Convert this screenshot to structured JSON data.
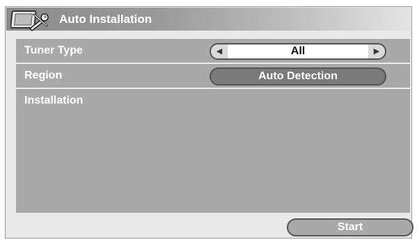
{
  "window": {
    "title": "Auto Installation",
    "title_icon": "tools-monitor-icon"
  },
  "rows": {
    "tuner_type": {
      "label": "Tuner Type",
      "value": "All",
      "left_arrow": "◀",
      "right_arrow": "▶"
    },
    "region": {
      "label": "Region",
      "value": "Auto Detection"
    },
    "installation": {
      "label": "Installation"
    }
  },
  "footer": {
    "start_label": "Start"
  },
  "colors": {
    "panel": "#a9a9a9",
    "window": "#e9e9e9",
    "button": "#7a7a7a",
    "text": "#ffffff"
  }
}
